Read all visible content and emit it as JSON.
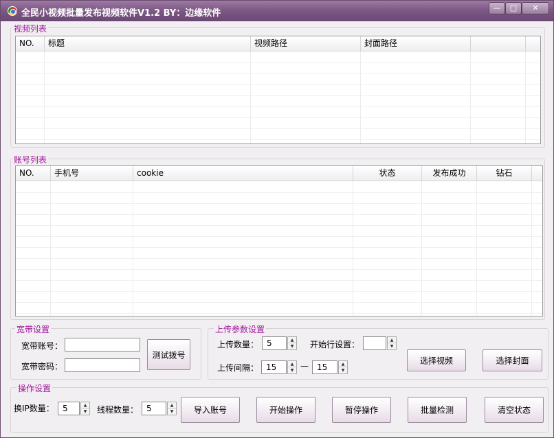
{
  "window": {
    "title": "全民小视频批量发布视频软件V1.2 BY：边缘软件",
    "controls": {
      "minimize": "—",
      "maximize": "□",
      "close": "✕"
    }
  },
  "video_list": {
    "title": "视频列表",
    "columns": [
      "NO.",
      "标题",
      "视频路径",
      "封面路径",
      ""
    ]
  },
  "account_list": {
    "title": "账号列表",
    "columns": [
      "NO.",
      "手机号",
      "cookie",
      "状态",
      "发布成功",
      "钻石"
    ]
  },
  "broadband": {
    "title": "宽带设置",
    "account_label": "宽带账号：",
    "account_value": "",
    "password_label": "宽带密码：",
    "password_value": "",
    "test_button": "测试拨号"
  },
  "upload": {
    "title": "上传参数设置",
    "count_label": "上传数量：",
    "count_value": "5",
    "start_row_label": "开始行设置：",
    "start_row_value": "",
    "interval_label": "上传间隔：",
    "interval_min": "15",
    "interval_sep": "—",
    "interval_max": "15",
    "select_video_button": "选择视频",
    "select_cover_button": "选择封面"
  },
  "operation": {
    "title": "操作设置",
    "ip_count_label": "换IP数量：",
    "ip_count_value": "5",
    "thread_count_label": "线程数量：",
    "thread_count_value": "5",
    "import_button": "导入账号",
    "start_button": "开始操作",
    "pause_button": "暂停操作",
    "check_button": "批量检测",
    "clear_button": "清空状态"
  }
}
